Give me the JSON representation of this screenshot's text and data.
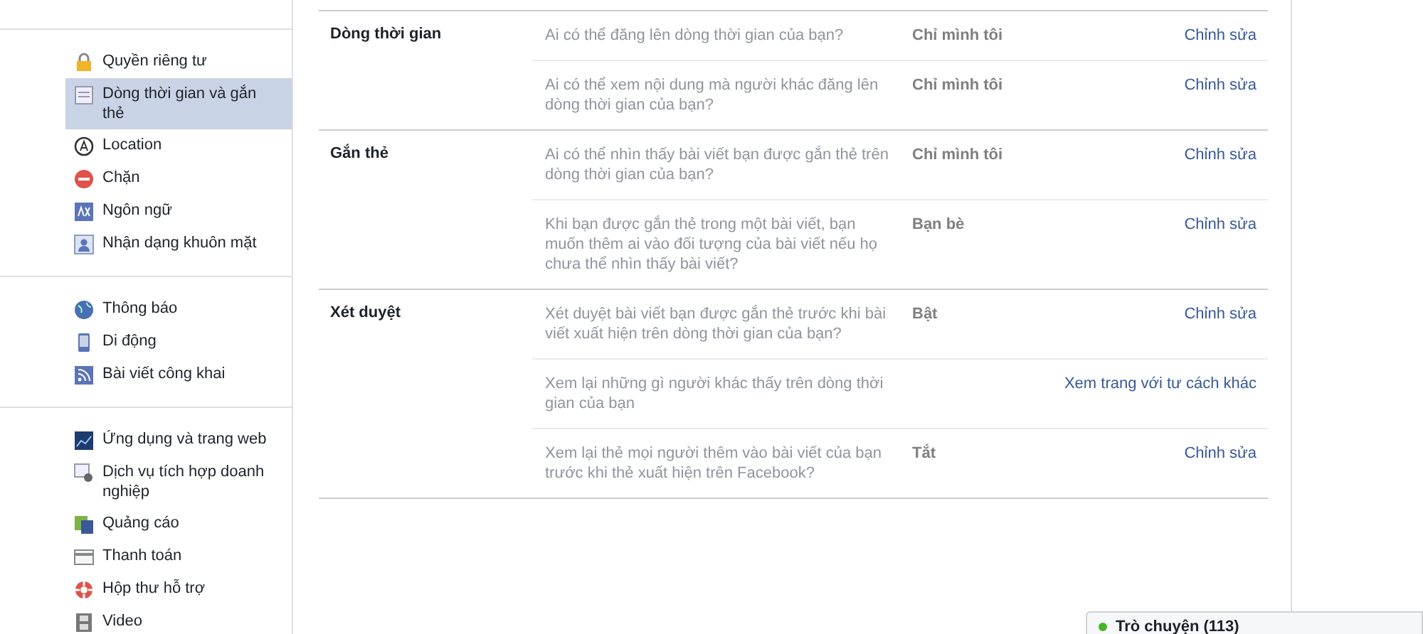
{
  "sidebar": {
    "groups": [
      {
        "items": [
          {
            "label": "Quyền riêng tư",
            "selected": false
          },
          {
            "label": "Dòng thời gian và gắn thẻ",
            "selected": true
          },
          {
            "label": "Location",
            "selected": false
          },
          {
            "label": "Chặn",
            "selected": false
          },
          {
            "label": "Ngôn ngữ",
            "selected": false
          },
          {
            "label": "Nhận dạng khuôn mặt",
            "selected": false
          }
        ]
      },
      {
        "items": [
          {
            "label": "Thông báo",
            "selected": false
          },
          {
            "label": "Di động",
            "selected": false
          },
          {
            "label": "Bài viết công khai",
            "selected": false
          }
        ]
      },
      {
        "items": [
          {
            "label": "Ứng dụng và trang web",
            "selected": false
          },
          {
            "label": "Dịch vụ tích hợp doanh nghiệp",
            "selected": false
          },
          {
            "label": "Quảng cáo",
            "selected": false
          },
          {
            "label": "Thanh toán",
            "selected": false
          },
          {
            "label": "Hộp thư hỗ trợ",
            "selected": false
          },
          {
            "label": "Video",
            "selected": false
          }
        ]
      }
    ]
  },
  "sections": [
    {
      "title": "Dòng thời gian",
      "rows": [
        {
          "question": "Ai có thể đăng lên dòng thời gian của bạn?",
          "value": "Chỉ mình tôi",
          "action": "Chỉnh sửa"
        },
        {
          "question": "Ai có thể xem nội dung mà người khác đăng lên dòng thời gian của bạn?",
          "value": "Chỉ mình tôi",
          "action": "Chỉnh sửa"
        }
      ]
    },
    {
      "title": "Gắn thẻ",
      "rows": [
        {
          "question": "Ai có thể nhìn thấy bài viết bạn được gắn thẻ trên dòng thời gian của bạn?",
          "value": "Chỉ mình tôi",
          "action": "Chỉnh sửa"
        },
        {
          "question": "Khi bạn được gắn thẻ trong một bài viết, bạn muốn thêm ai vào đối tượng của bài viết nếu họ chưa thể nhìn thấy bài viết?",
          "value": "Bạn bè",
          "action": "Chỉnh sửa"
        }
      ]
    },
    {
      "title": "Xét duyệt",
      "rows": [
        {
          "question": "Xét duyệt bài viết bạn được gắn thẻ trước khi bài viết xuất hiện trên dòng thời gian của bạn?",
          "value": "Bật",
          "action": "Chỉnh sửa"
        },
        {
          "question": "Xem lại những gì người khác thấy trên dòng thời gian của bạn",
          "action": "Xem trang với tư cách khác"
        },
        {
          "question": "Xem lại thẻ mọi người thêm vào bài viết của bạn trước khi thẻ xuất hiện trên Facebook?",
          "value": "Tắt",
          "action": "Chỉnh sửa"
        }
      ]
    }
  ],
  "chat": {
    "label": "Trò chuyện (113)",
    "online": true
  }
}
